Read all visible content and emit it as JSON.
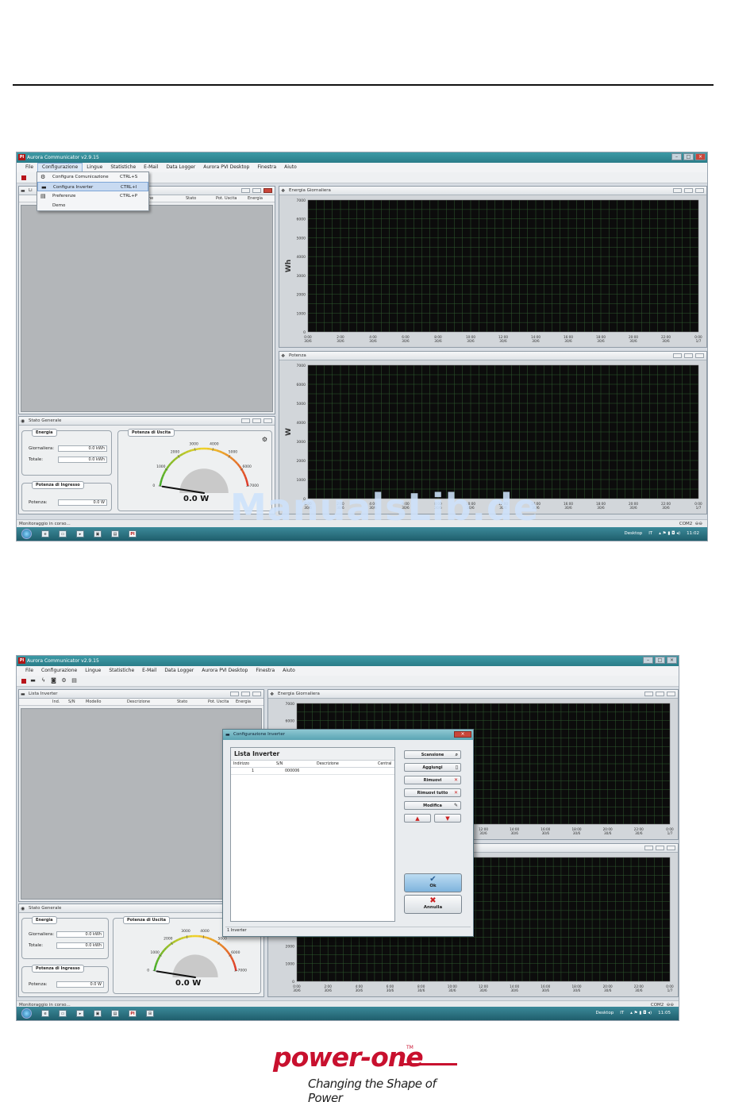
{
  "app": {
    "title": "Aurora Communicator v2.9.15",
    "menu": [
      "File",
      "Configurazione",
      "Lingue",
      "Statistiche",
      "E-Mail",
      "Data Logger",
      "Aurora PVI Desktop",
      "Finestra",
      "Aiuto"
    ]
  },
  "screen1": {
    "dropdown": [
      {
        "label": "Configura Comunicazione",
        "shortcut": "CTRL+S",
        "icon": "gear-icon"
      },
      {
        "label": "Configura Inverter",
        "shortcut": "CTRL+I",
        "icon": "inverter-icon"
      },
      {
        "label": "Preferenze",
        "shortcut": "CTRL+P",
        "icon": "preferences-icon"
      },
      {
        "label": "Demo",
        "shortcut": "",
        "icon": ""
      }
    ],
    "list_title": "Li",
    "list_columns": [
      "ne",
      "Stato",
      "Pot. Uscita",
      "Energia"
    ]
  },
  "inverter_list": {
    "title": "Lista Inverter",
    "columns": [
      "Ind.",
      "S/N",
      "Modello",
      "Descrizione",
      "Stato",
      "Pot. Uscita",
      "Energia"
    ]
  },
  "charts": {
    "energy": {
      "title": "Energia Giornaliera",
      "ylabel": "Wh",
      "yticks": [
        "7000",
        "6000",
        "5000",
        "4000",
        "3000",
        "2000",
        "1000",
        "0"
      ],
      "xticks": [
        [
          "0:00",
          "30/6"
        ],
        [
          "2:00",
          "30/6"
        ],
        [
          "4:00",
          "30/6"
        ],
        [
          "6:00",
          "30/6"
        ],
        [
          "8:00",
          "30/6"
        ],
        [
          "10:00",
          "30/6"
        ],
        [
          "12:00",
          "30/6"
        ],
        [
          "14:00",
          "30/6"
        ],
        [
          "16:00",
          "30/6"
        ],
        [
          "18:00",
          "30/6"
        ],
        [
          "20:00",
          "30/6"
        ],
        [
          "22:00",
          "30/6"
        ],
        [
          "0:00",
          "1/7"
        ]
      ]
    },
    "power": {
      "title": "Potenza",
      "ylabel": "W",
      "yticks": [
        "7000",
        "6000",
        "5000",
        "4000",
        "3000",
        "2000",
        "1000",
        "0"
      ]
    }
  },
  "chart_data": [
    {
      "type": "line",
      "title": "Energia Giornaliera",
      "xlabel": "",
      "ylabel": "Wh",
      "ylim": [
        0,
        7000
      ],
      "categories": [
        "0:00 30/6",
        "2:00 30/6",
        "4:00 30/6",
        "6:00 30/6",
        "8:00 30/6",
        "10:00 30/6",
        "12:00 30/6",
        "14:00 30/6",
        "16:00 30/6",
        "18:00 30/6",
        "20:00 30/6",
        "22:00 30/6",
        "0:00 1/7"
      ],
      "series": [],
      "grid": true
    },
    {
      "type": "line",
      "title": "Potenza",
      "xlabel": "",
      "ylabel": "W",
      "ylim": [
        0,
        7000
      ],
      "categories": [
        "0:00 30/6",
        "2:00 30/6",
        "4:00 30/6",
        "6:00 30/6",
        "8:00 30/6",
        "10:00 30/6",
        "12:00 30/6",
        "14:00 30/6",
        "16:00 30/6",
        "18:00 30/6",
        "20:00 30/6",
        "22:00 30/6",
        "0:00 1/7"
      ],
      "series": [],
      "grid": true
    }
  ],
  "status": {
    "title": "Stato Generale",
    "energy_group": "Energia",
    "daily_label": "Giornaliera:",
    "daily_value": "0.0 kWh",
    "total_label": "Totale:",
    "total_value": "0.0 kWh",
    "input_group": "Potenza di Ingresso",
    "power_label": "Potenza:",
    "power_value": "0.0 W",
    "gauge_title": "Potenza di Uscita",
    "gauge_ticks_1": [
      "0",
      "1000",
      "2000",
      "3000",
      "4000",
      "5000",
      "6000",
      "7000"
    ],
    "gauge_ticks_2": [
      "0",
      "1000",
      "2000",
      "3000",
      "4000",
      "5000",
      "6000",
      "7000"
    ],
    "gauge_value": "0.0 W",
    "gauge_level": 0
  },
  "statusbar": {
    "text": "Monitoraggio in corso...",
    "port": "COM2"
  },
  "taskbar": {
    "desktop": "Desktop",
    "lang": "IT",
    "time_1": "11:02",
    "time_2": "11:05"
  },
  "dialog": {
    "title": "Configurazione Inverter",
    "list_title": "Lista Inverter",
    "columns": [
      "Indirizzo",
      "S/N",
      "Descrizione",
      "Central"
    ],
    "rows": [
      {
        "address": "1",
        "sn": "000006",
        "desc": "",
        "central": ""
      }
    ],
    "buttons": {
      "scan": "Scansione",
      "add": "Aggiungi",
      "remove": "Rimuovi",
      "remove_all": "Rimuovi tutto",
      "edit": "Modifica",
      "ok": "Ok",
      "cancel": "Annulla"
    },
    "footer": "1 Inverter"
  },
  "watermark": "ManualsLib.de",
  "logo": {
    "word": "power-one",
    "tm": "TM",
    "tagline": "Changing the Shape of Power"
  }
}
